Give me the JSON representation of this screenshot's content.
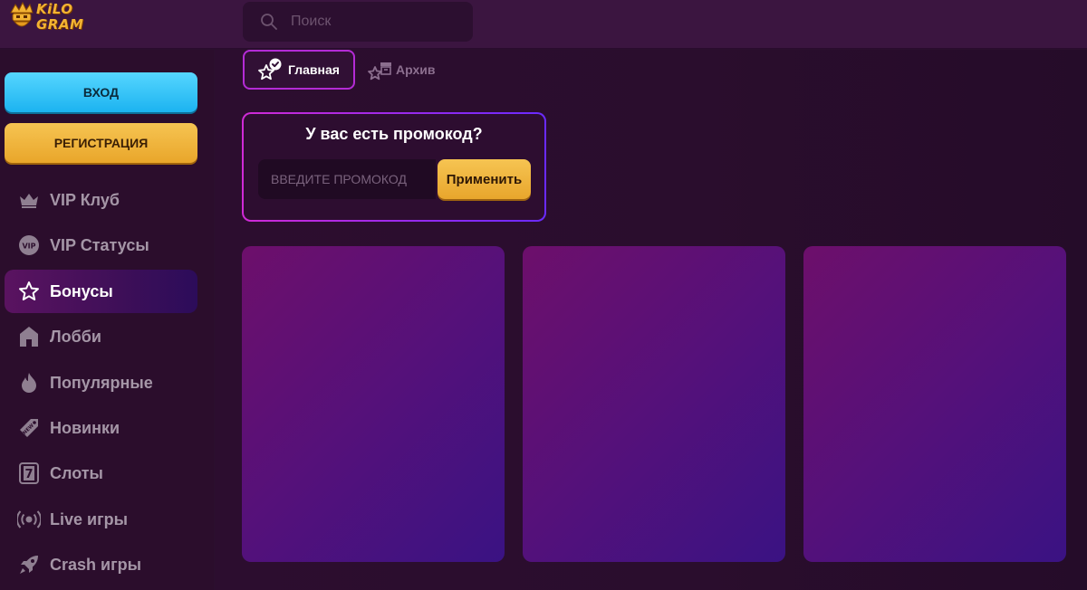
{
  "header": {
    "logo_text_line1": "KiLO",
    "logo_text_line2": "GRAM",
    "search_placeholder": "Поиск"
  },
  "sidebar": {
    "login_label": "ВХОД",
    "register_label": "РЕГИСТРАЦИЯ",
    "items": [
      {
        "label": "VIP Клуб",
        "icon": "crown-icon"
      },
      {
        "label": "VIP Статусы",
        "icon": "vip-badge-icon"
      },
      {
        "label": "Бонусы",
        "icon": "star-icon",
        "active": true
      },
      {
        "label": "Лобби",
        "icon": "home-icon"
      },
      {
        "label": "Популярные",
        "icon": "flame-icon"
      },
      {
        "label": "Новинки",
        "icon": "new-tag-icon"
      },
      {
        "label": "Слоты",
        "icon": "slot-seven-icon"
      },
      {
        "label": "Live игры",
        "icon": "broadcast-icon"
      },
      {
        "label": "Crash игры",
        "icon": "rocket-icon"
      }
    ]
  },
  "tabs": {
    "main_label": "Главная",
    "archive_label": "Архив"
  },
  "promo": {
    "title": "У вас есть промокод?",
    "input_placeholder": "ВВЕДИТЕ ПРОМОКОД",
    "apply_label": "Применить"
  },
  "colors": {
    "accent_blue": "#1cb3f0",
    "accent_gold": "#eaa82c",
    "accent_purple": "#b42bd6",
    "background": "#2a0f2d"
  },
  "cards": [
    {
      "kind": "bonus-card-placeholder"
    },
    {
      "kind": "bonus-card-placeholder"
    },
    {
      "kind": "bonus-card-placeholder"
    }
  ]
}
